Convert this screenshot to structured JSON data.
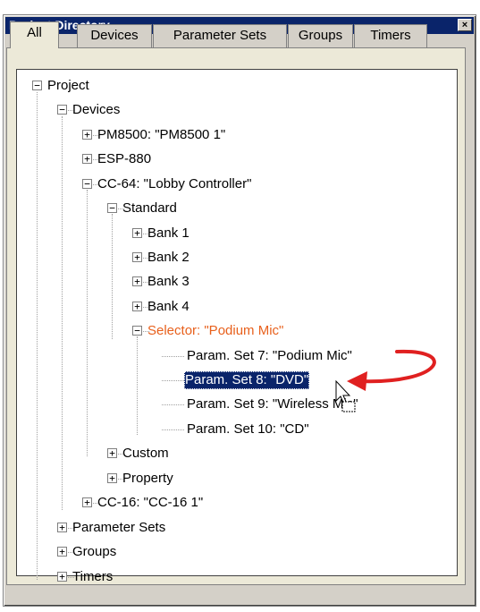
{
  "window": {
    "title": "Project Directory",
    "close_glyph": "×"
  },
  "tabs": [
    {
      "label": "All",
      "active": true
    },
    {
      "label": "Devices",
      "active": false
    },
    {
      "label": "Parameter Sets",
      "active": false
    },
    {
      "label": "Groups",
      "active": false
    },
    {
      "label": "Timers",
      "active": false
    }
  ],
  "tree": [
    {
      "label": "Project",
      "expander": "−"
    },
    {
      "label": "Devices",
      "expander": "−"
    },
    {
      "label": "PM8500: \"PM8500 1\"",
      "expander": "+"
    },
    {
      "label": "ESP-880",
      "expander": "+"
    },
    {
      "label": "CC-64: \"Lobby Controller\"",
      "expander": "−"
    },
    {
      "label": "Standard",
      "expander": "−"
    },
    {
      "label": "Bank 1",
      "expander": "+"
    },
    {
      "label": "Bank 2",
      "expander": "+"
    },
    {
      "label": "Bank 3",
      "expander": "+"
    },
    {
      "label": "Bank 4",
      "expander": "+"
    },
    {
      "label": "Selector: \"Podium Mic\"",
      "expander": "−",
      "highlight": "orange"
    },
    {
      "label": "Param. Set 7: \"Podium Mic\""
    },
    {
      "label": "Param. Set 8: \"DVD\"",
      "selected": true
    },
    {
      "label": "Param. Set 9: \"Wireless Mic\""
    },
    {
      "label": "Param. Set 10: \"CD\""
    },
    {
      "label": "Custom",
      "expander": "+"
    },
    {
      "label": "Property",
      "expander": "+"
    },
    {
      "label": "CC-16: \"CC-16 1\"",
      "expander": "+"
    },
    {
      "label": "Parameter Sets",
      "expander": "+"
    },
    {
      "label": "Groups",
      "expander": "+"
    },
    {
      "label": "Timers",
      "expander": "+"
    }
  ],
  "annotation": {
    "color": "#e02020",
    "cursor": "drag-move-cursor-icon"
  }
}
